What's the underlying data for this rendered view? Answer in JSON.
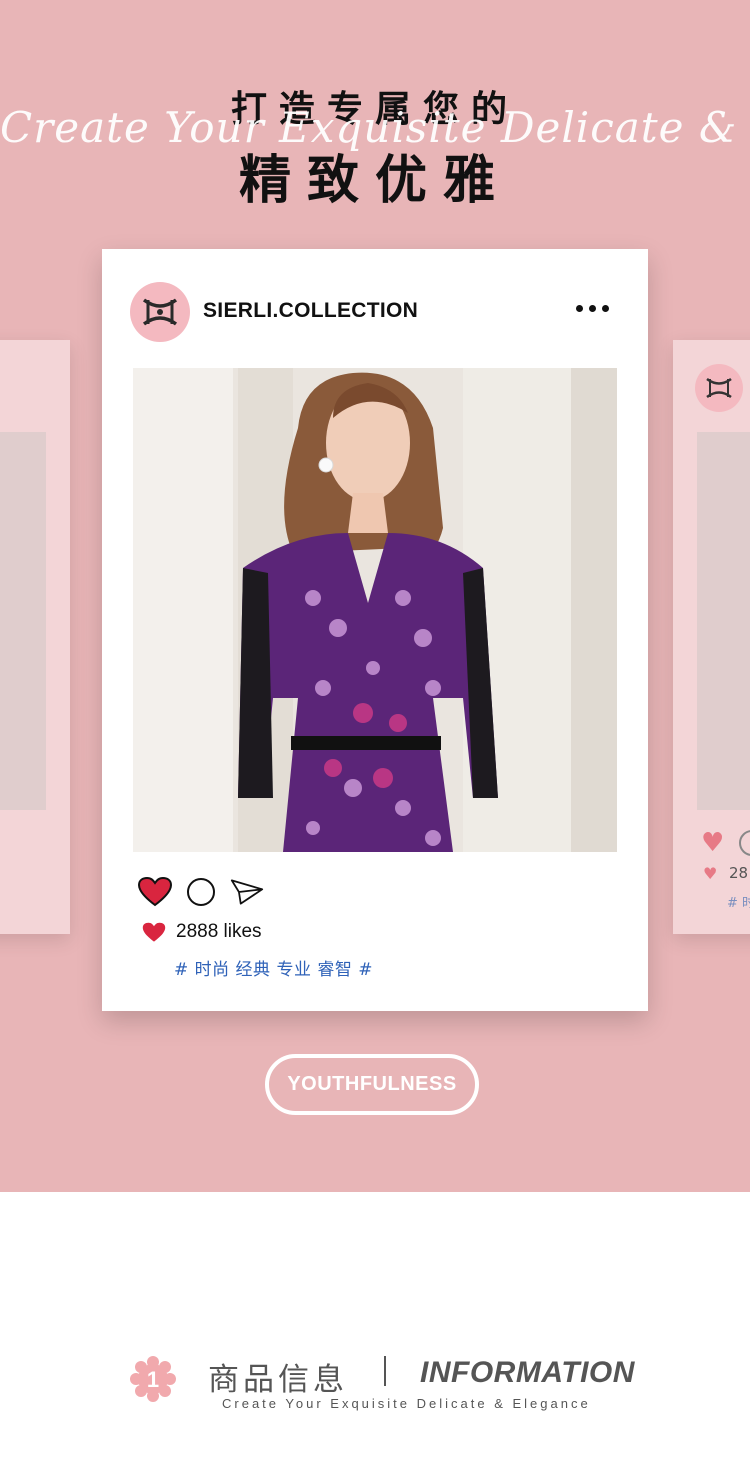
{
  "hero": {
    "title_line1": "打造专属您的",
    "script_line": "Create Your Exquisite Delicate & Elegance",
    "title_line2": "精致优雅"
  },
  "post": {
    "username": "SIERLI.COLLECTION",
    "more_icon": "more-dots-icon",
    "likes": "2888 likes",
    "tags": "# 时尚 经典 专业 睿智 #",
    "actions": [
      "heart-icon",
      "comment-icon",
      "share-icon"
    ]
  },
  "side_card": {
    "likes_partial": "28",
    "tag_partial": "# 时"
  },
  "cta": {
    "label": "YOUTHFULNESS"
  },
  "info": {
    "badge_number": "1",
    "title_cn": "商品信息",
    "title_en": "INFORMATION",
    "subtitle": "Create Your Exquisite Delicate & Elegance"
  },
  "colors": {
    "background_pink": "#e8b5b7",
    "heart_red": "#d9253f",
    "tag_blue": "#2f62b8",
    "badge_pink": "#f1a9ad"
  }
}
